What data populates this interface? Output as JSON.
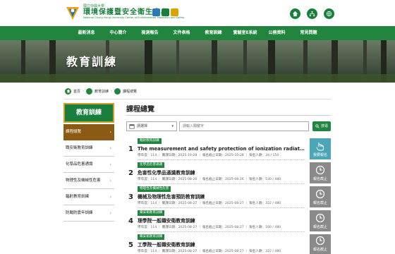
{
  "header": {
    "university": "國立中興大學",
    "center_name": "環境保護暨安全衛生中心",
    "center_name_en": "National Chung Hsing University Center of Environmental Protection and Safety"
  },
  "nav": {
    "items": [
      "最新消息",
      "中心簡介",
      "檢測報告",
      "文件表格",
      "教育訓練",
      "實驗室E系統",
      "公務資料",
      "常見問題"
    ]
  },
  "banner": {
    "title": "教育訓練"
  },
  "breadcrumb": {
    "home": "首頁",
    "section": "教育訓練",
    "current": "課程總覽",
    "sep": "›"
  },
  "sidebar": {
    "title": "教育訓練",
    "items": [
      {
        "label": "課程總覽",
        "active": true
      },
      {
        "label": "職安衛教育訓練",
        "active": false
      },
      {
        "label": "化學品危害通識",
        "active": false
      },
      {
        "label": "物理性及機械性危害",
        "active": false
      },
      {
        "label": "輻射教育訓練",
        "active": false
      },
      {
        "label": "防颱防震年訓練",
        "active": false
      }
    ]
  },
  "main": {
    "title": "課程總覽",
    "select_label": "請選擇",
    "search_placeholder": "請輸入關鍵字",
    "search_button": "搜尋"
  },
  "courses": [
    {
      "num": "1",
      "tag": "輻射教育訓練",
      "name": "The measurement and safety protection of ionization radiation.核輻射安全...",
      "meta": "學年度：114 ｜ 實課日期：2025-10-28 ｜ 報名截止日期：2025-10-28 ｜ 報名人數：34 / 150",
      "button": "我要報名",
      "status": "open"
    },
    {
      "num": "2",
      "tag": "化學品危害通識",
      "name": "危害性化學品通識教育訓練",
      "meta": "學年度：114 ｜ 實課日期：2025-08-26 ｜ 報名截止日期：2025-08-26 ｜ 報名人數：530 / 480",
      "button": "報名截止",
      "status": "closed"
    },
    {
      "num": "3",
      "tag": "物理性及機械性危害",
      "name": "機械及物理性危害預防教育訓練",
      "meta": "學年度：114 ｜ 實課日期：2025-08-27 ｜ 報名截止日期：2025-08-27 ｜ 報名人數：322 / 480",
      "button": "報名截止",
      "status": "closed"
    },
    {
      "num": "4",
      "tag": "職安衛教育訓練",
      "name": "理學院一般職安衛教育訓練",
      "meta": "學年度：114 ｜ 實課日期：2025-08-27 ｜ 報名截止日期：2025-08-27 ｜ 報名人數：160 / 480",
      "button": "報名截止",
      "status": "closed"
    },
    {
      "num": "5",
      "tag": "職安衛教育訓練",
      "name": "工學院一般職安衛教育訓練",
      "meta": "學年度：114 ｜ 實課日期：2025-08-27 ｜ 報名截止日期：2025-08-27 ｜ 報名人數：322 / 480",
      "button": "報名截止",
      "status": "closed"
    }
  ],
  "colors": {
    "primary": "#21843f",
    "sidebar_active": "#8b5a14",
    "open_button": "#4da6b8",
    "closed_button": "#8a8a8a",
    "gold": "#c9a227"
  }
}
